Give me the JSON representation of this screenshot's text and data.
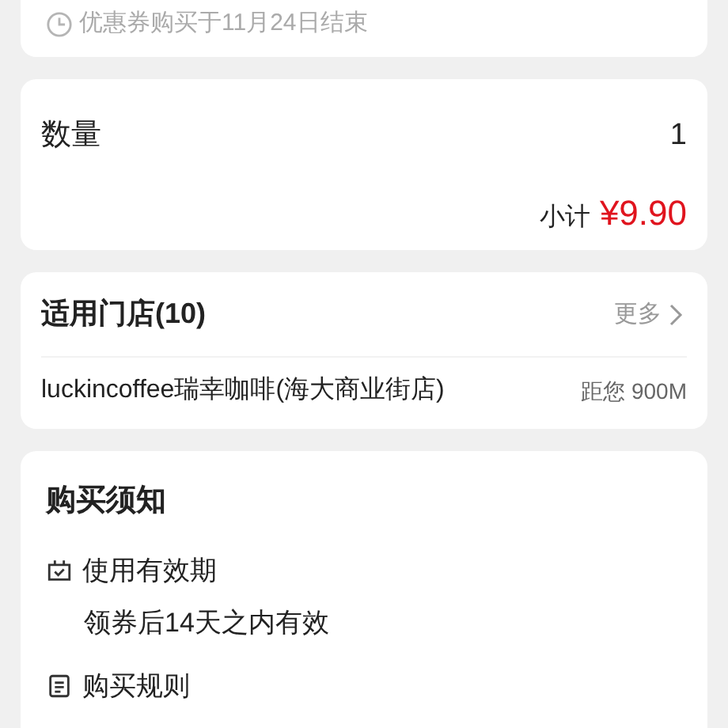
{
  "coupon_notice": {
    "text": "优惠券购买于11月24日结束"
  },
  "quantity": {
    "label": "数量",
    "value": "1",
    "subtotal_label": "小计",
    "subtotal_value": "¥9.90"
  },
  "stores": {
    "title": "适用门店(10)",
    "more": "更多",
    "items": [
      {
        "name": "luckincoffee瑞幸咖啡(海大商业街店)",
        "distance": "距您 900M"
      }
    ]
  },
  "notice": {
    "title": "购买须知",
    "sections": [
      {
        "kind": "validity",
        "title": "使用有效期",
        "text": "领券后14天之内有效"
      },
      {
        "kind": "rules",
        "title": "购买规则"
      }
    ]
  }
}
